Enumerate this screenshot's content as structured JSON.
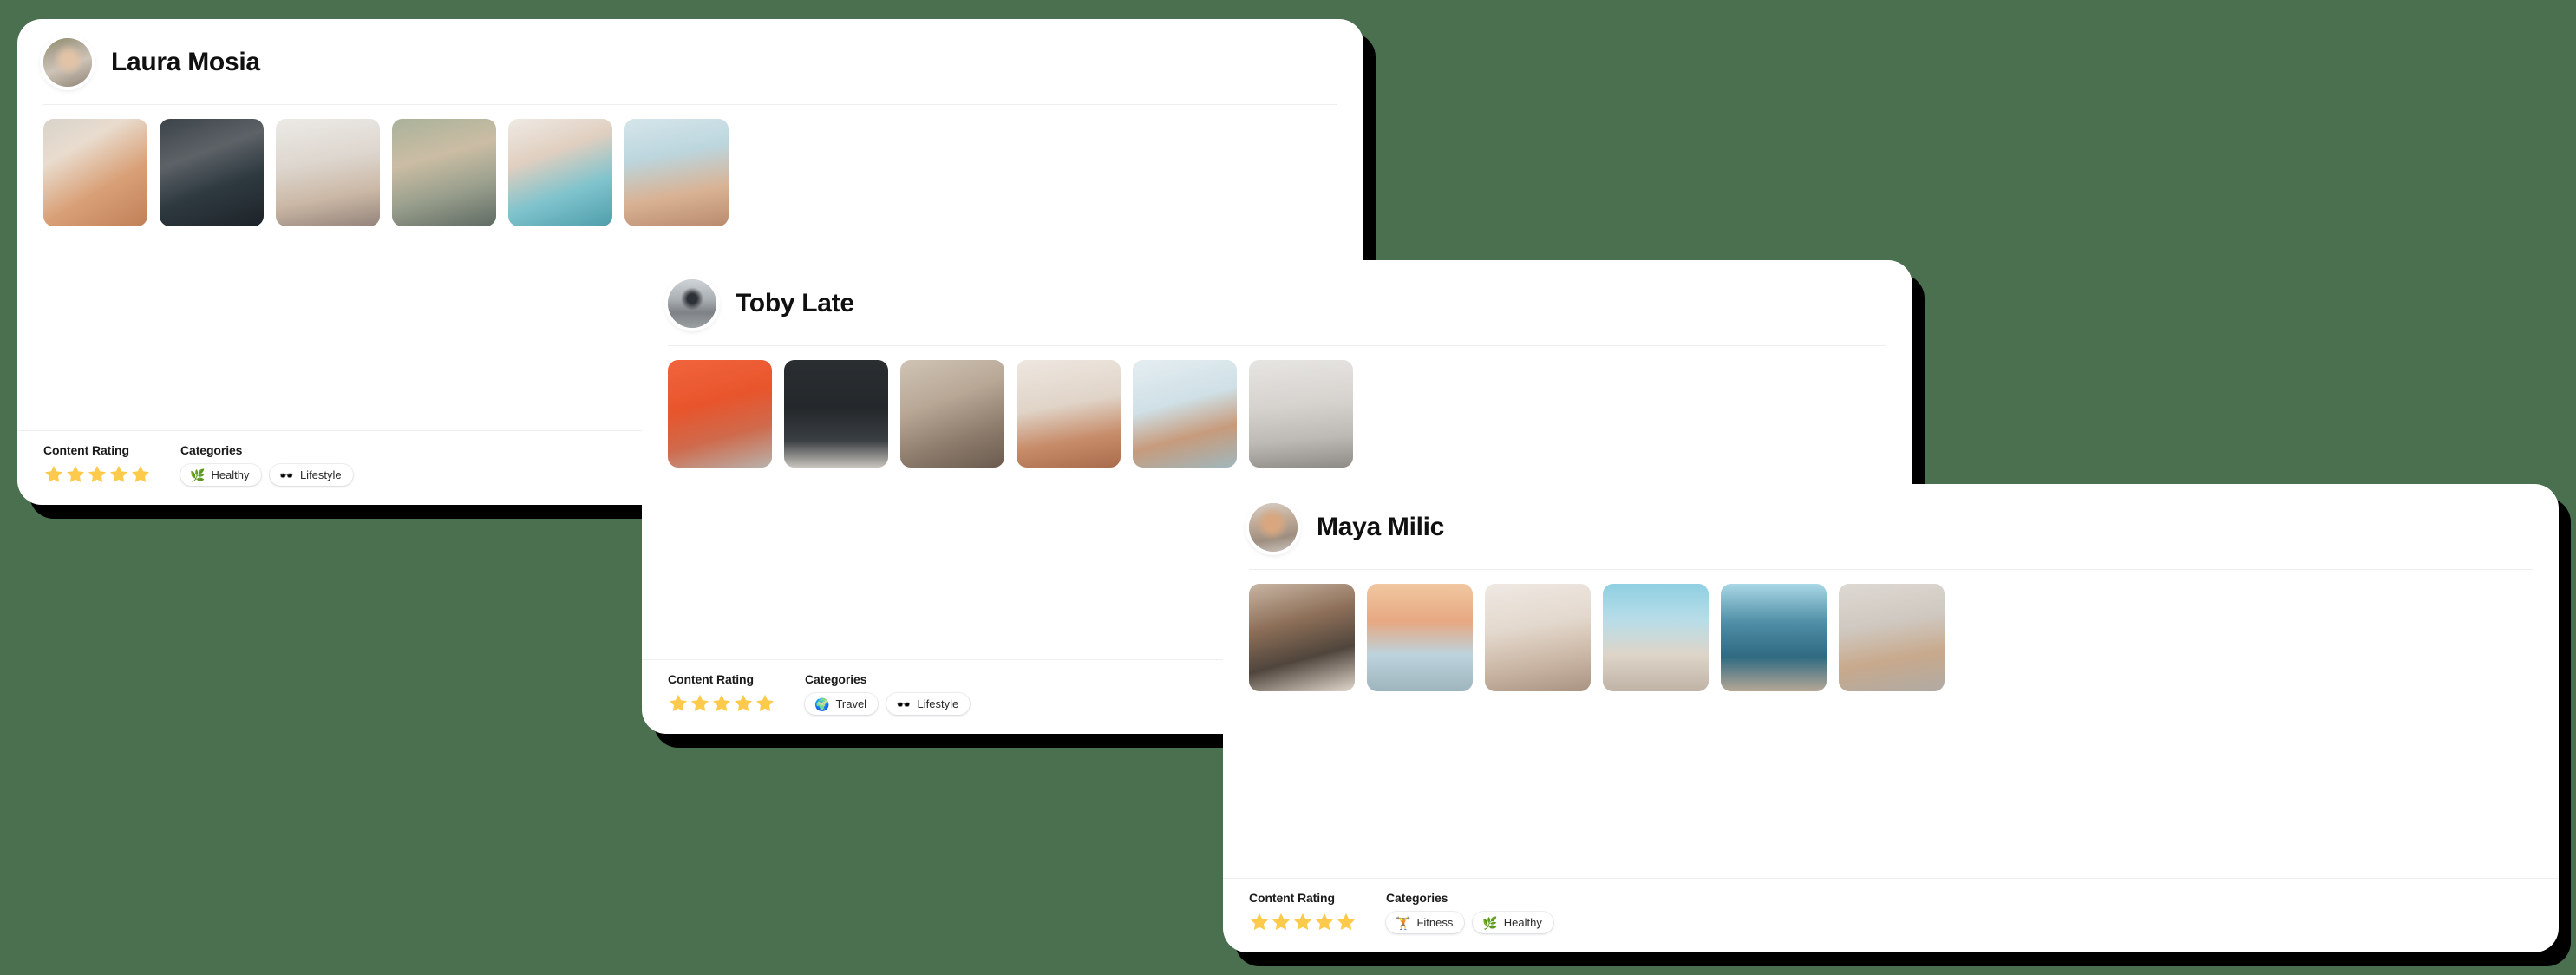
{
  "background_color": "#4a7050",
  "accent_star_color": "#fdca4b",
  "cards": [
    {
      "id": "laura",
      "name": "Laura Mosia",
      "avatar_icon": "avatar-photo-laura",
      "rating_label": "Content Rating",
      "rating_value": 5,
      "rating_max": 5,
      "categories_label": "Categories",
      "categories": [
        {
          "label": "Healthy",
          "emoji": "🌿",
          "icon_name": "herb-icon"
        },
        {
          "label": "Lifestyle",
          "emoji": "🕶️",
          "icon_name": "sunglasses-icon"
        }
      ],
      "gallery": [
        {
          "alt": "woman-holding-smoothie-bowl",
          "class": "p-coffee"
        },
        {
          "alt": "woman-in-sportswear-by-door",
          "class": "p-gymdoor"
        },
        {
          "alt": "mirror-selfie-in-bedroom",
          "class": "p-mirror"
        },
        {
          "alt": "woman-sitting-by-lake",
          "class": "p-lake"
        },
        {
          "alt": "hands-holding-blue-scrub",
          "class": "p-hands"
        },
        {
          "alt": "close-up-portrait-wet-hair",
          "class": "p-face"
        }
      ]
    },
    {
      "id": "toby",
      "name": "Toby Late",
      "avatar_icon": "avatar-photo-toby",
      "rating_label": "Content Rating",
      "rating_value": 5,
      "rating_max": 5,
      "categories_label": "Categories",
      "categories": [
        {
          "label": "Travel",
          "emoji": "🌍",
          "icon_name": "globe-icon"
        },
        {
          "label": "Lifestyle",
          "emoji": "🕶️",
          "icon_name": "sunglasses-icon"
        }
      ],
      "gallery": [
        {
          "alt": "man-sitting-against-orange-wall",
          "class": "p-orange"
        },
        {
          "alt": "man-standing-dark-wall",
          "class": "p-darkwall"
        },
        {
          "alt": "man-by-graffiti-wall",
          "class": "p-graffiti"
        },
        {
          "alt": "man-on-street-corner",
          "class": "p-street"
        },
        {
          "alt": "blue-toned-portrait",
          "class": "p-blue"
        },
        {
          "alt": "white-brick-wall-scene",
          "class": "p-brick"
        }
      ]
    },
    {
      "id": "maya",
      "name": "Maya Milic",
      "avatar_icon": "avatar-photo-maya",
      "rating_label": "Content Rating",
      "rating_value": 5,
      "rating_max": 5,
      "categories_label": "Categories",
      "categories": [
        {
          "label": "Fitness",
          "emoji": "🏋️",
          "icon_name": "dumbbell-icon"
        },
        {
          "label": "Healthy",
          "emoji": "🌿",
          "icon_name": "herb-icon"
        }
      ],
      "gallery": [
        {
          "alt": "woman-doing-pull-ups",
          "class": "p-pullup"
        },
        {
          "alt": "woman-on-rooftop-at-sunset",
          "class": "p-rooftop"
        },
        {
          "alt": "friends-sitting-on-rug",
          "class": "p-friends"
        },
        {
          "alt": "woman-stretching-on-bench",
          "class": "p-bench"
        },
        {
          "alt": "woman-on-balcony-by-the-sea",
          "class": "p-sea"
        },
        {
          "alt": "woman-sitting-on-couch",
          "class": "p-couch"
        }
      ]
    }
  ]
}
